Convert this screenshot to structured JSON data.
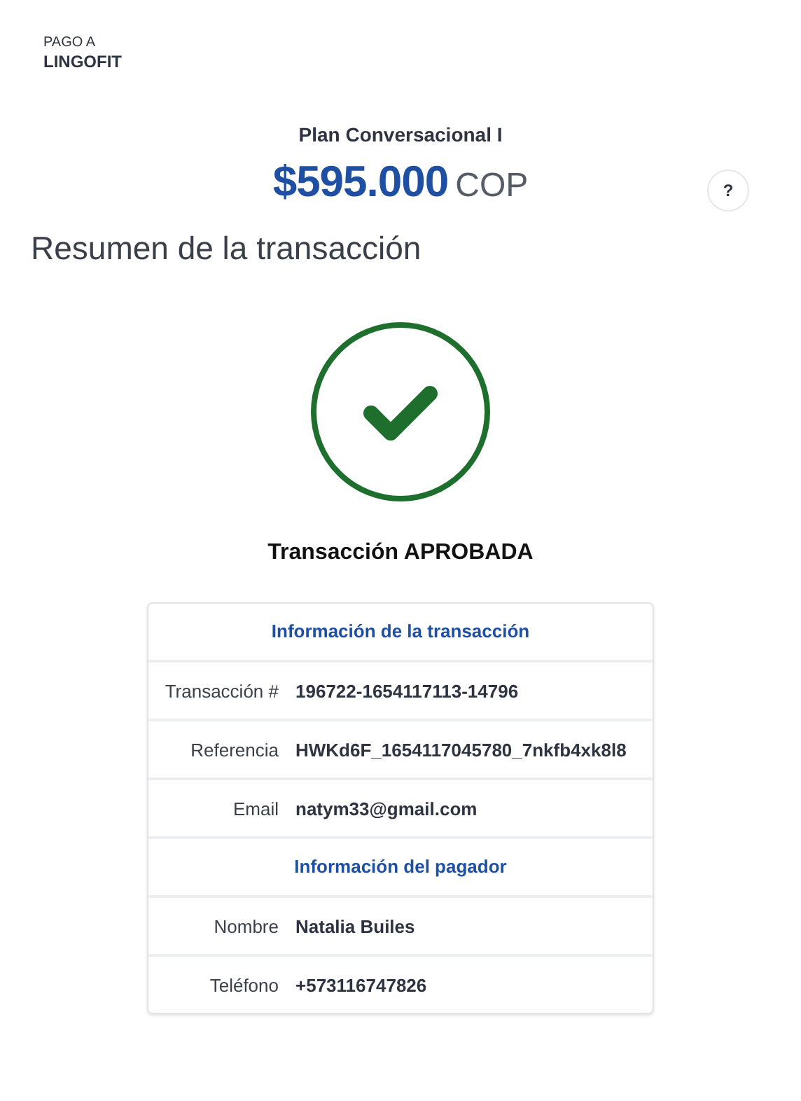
{
  "merchant": {
    "label": "PAGO A",
    "name": "LINGOFIT"
  },
  "product": {
    "title": "Plan Conversacional I",
    "amount": "$595.000",
    "currency": "COP",
    "help": "?"
  },
  "heading": "Resumen de la transacción",
  "result": {
    "text": "Transacción APROBADA"
  },
  "table": [
    {
      "kind": "section",
      "title": "Información de la transacción"
    },
    {
      "kind": "row",
      "label": "Transacción #",
      "value": "196722-1654117113-14796"
    },
    {
      "kind": "row",
      "label": "Referencia",
      "value": "HWKd6F_1654117045780_7nkfb4xk8l8"
    },
    {
      "kind": "row",
      "label": "Email",
      "value": "natym33@gmail.com"
    },
    {
      "kind": "section",
      "title": "Información del pagador"
    },
    {
      "kind": "row",
      "label": "Nombre",
      "value": "Natalia Builes"
    },
    {
      "kind": "row",
      "label": "Teléfono",
      "value": "+573116747826"
    }
  ]
}
